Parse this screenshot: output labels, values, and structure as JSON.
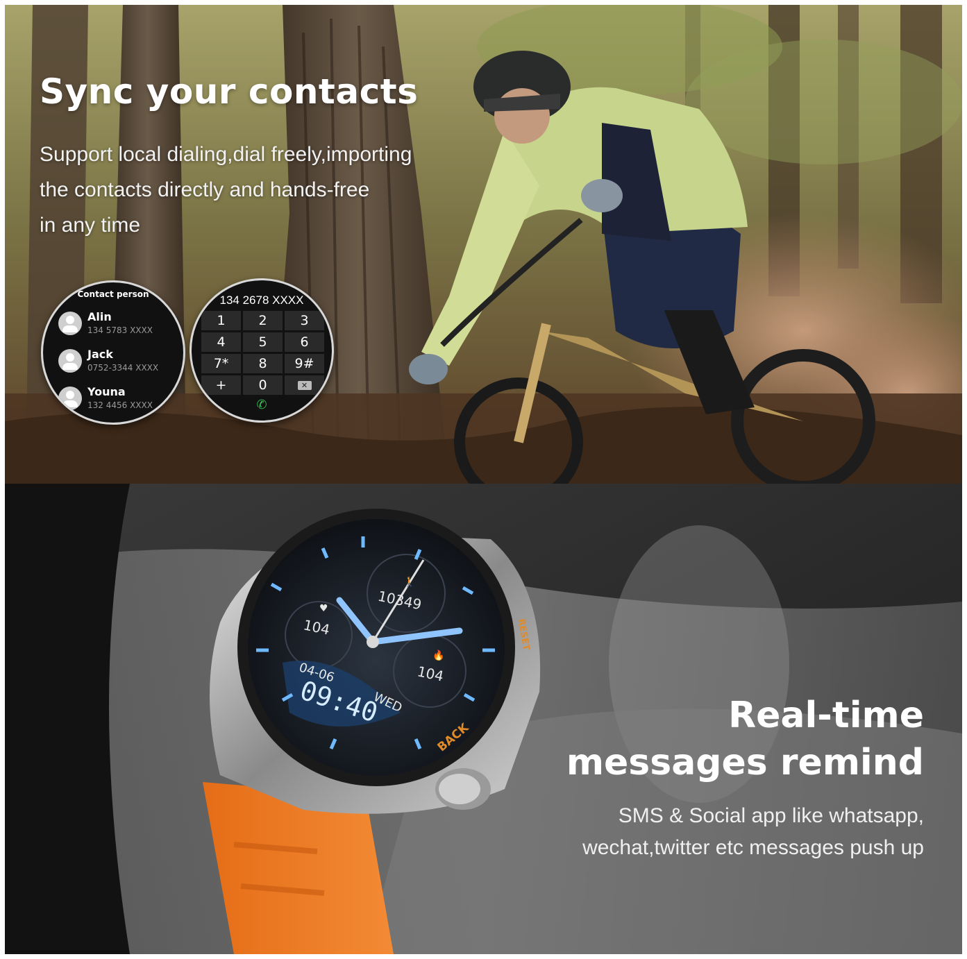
{
  "top_panel": {
    "headline": "Sync your contacts",
    "subtext_lines": [
      "Support local dialing,dial freely,importing",
      "the contacts directly and hands-free",
      "in any time"
    ],
    "contacts_watch": {
      "title": "Contact person",
      "contacts": [
        {
          "name": "Alin",
          "number": "134 5783 XXXX"
        },
        {
          "name": "Jack",
          "number": "0752-3344 XXXX"
        },
        {
          "name": "Youna",
          "number": "132 4456 XXXX"
        }
      ]
    },
    "dial_watch": {
      "number": "134 2678 XXXX",
      "keys": [
        "1",
        "2",
        "3",
        "4",
        "5",
        "6",
        "7*",
        "8",
        "9#",
        "+",
        "0"
      ],
      "delete_icon": "backspace-icon",
      "call_icon": "phone-icon"
    }
  },
  "bottom_panel": {
    "headline_lines": [
      "Real-time",
      "messages remind"
    ],
    "subtext_lines": [
      "SMS & Social app like whatsapp,",
      "wechat,twitter etc messages push up"
    ],
    "watch_face": {
      "steps": "10349",
      "heart_rate": "104",
      "calories": "104",
      "date": "04-06",
      "day": "WED",
      "time": "09:40",
      "bezel_labels": [
        "BACK",
        "RESET"
      ],
      "heart_icon": "heart-icon",
      "steps_icon": "walker-icon",
      "flame_icon": "flame-icon"
    },
    "strap_color": "#f07b22"
  }
}
